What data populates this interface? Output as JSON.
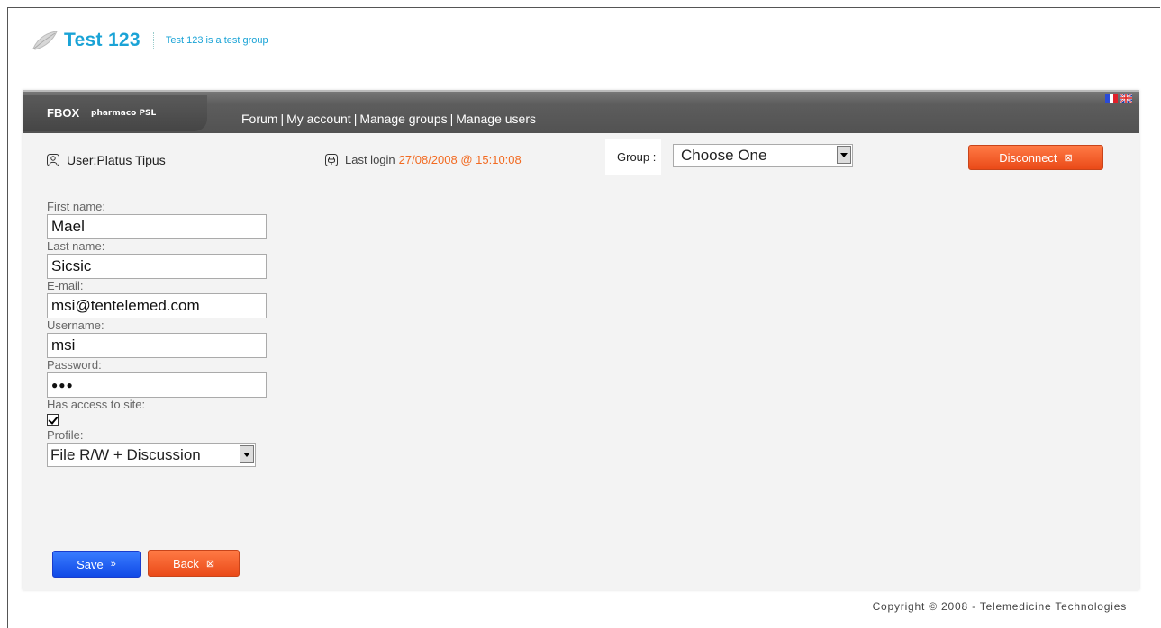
{
  "header": {
    "group_name": "Test 123",
    "group_description": "Test 123 is a test group"
  },
  "navbar": {
    "brand": "FBOX",
    "brand_sub": "pharmaco PSL",
    "links": [
      "Forum",
      "My account",
      "Manage groups",
      "Manage users"
    ],
    "separator": "|"
  },
  "info": {
    "user_text": "User:Platus Tipus",
    "last_login_label": "Last login",
    "last_login_value": "27/08/2008 @ 15:10:08",
    "group_label": "Group :",
    "group_selected": "Choose One",
    "disconnect_label": "Disconnect"
  },
  "form": {
    "first_name_label": "First name:",
    "first_name_value": "Mael",
    "last_name_label": "Last name:",
    "last_name_value": "Sicsic",
    "email_label": "E-mail:",
    "email_value": "msi@tentelemed.com",
    "username_label": "Username:",
    "username_value": "msi",
    "password_label": "Password:",
    "password_value": "●●●",
    "access_label": "Has access to site:",
    "access_checked": true,
    "profile_label": "Profile:",
    "profile_selected": "File R/W + Discussion"
  },
  "buttons": {
    "save_label": "Save",
    "save_glyph": "»",
    "back_label": "Back",
    "close_glyph": "⊠"
  },
  "footer": {
    "copyright": "Copyright © 2008 - Telemedicine Technologies"
  },
  "colors": {
    "accent_blue": "#1aa3d6",
    "accent_orange": "#f26a21",
    "navbar": "#555555"
  }
}
